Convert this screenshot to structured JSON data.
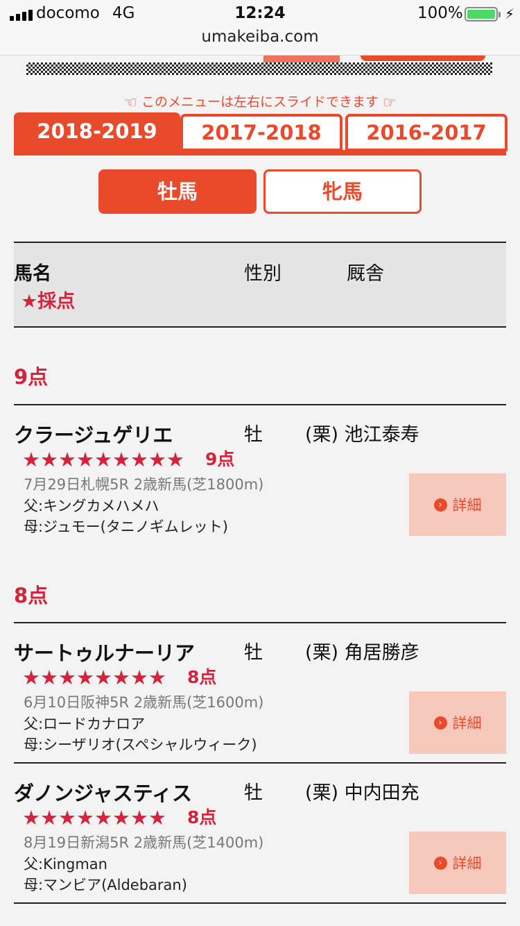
{
  "status_bar": {
    "carrier": "docomo",
    "network": "4G",
    "time": "12:24",
    "battery": "100%",
    "url": "umakeiba.com"
  },
  "slide_hint": "このメニューは左右にスライドできます",
  "year_tabs": [
    "2018-2019",
    "2017-2018",
    "2016-2017"
  ],
  "gender_tabs": {
    "colt": "牡馬",
    "filly": "牝馬"
  },
  "table_header": {
    "name": "馬名",
    "sex": "性別",
    "stable": "厩舎",
    "score": "★採点"
  },
  "groups": [
    {
      "label": "9点"
    },
    {
      "label": "8点"
    }
  ],
  "horses": [
    {
      "name": "クラージュゲリエ",
      "sex": "牡",
      "stable": "(栗) 池江泰寿",
      "stars": "★★★★★★★★★",
      "score": "9点",
      "race": "7月29日札幌5R 2歳新馬(芝1800m)",
      "sire": "父:キングカメハメハ",
      "dam": "母:ジュモー(タニノギムレット)",
      "detail": "詳細"
    },
    {
      "name": "サートゥルナーリア",
      "sex": "牡",
      "stable": "(栗) 角居勝彦",
      "stars": "★★★★★★★★",
      "score": "8点",
      "race": "6月10日阪神5R 2歳新馬(芝1600m)",
      "sire": "父:ロードカナロア",
      "dam": "母:シーザリオ(スペシャルウィーク)",
      "detail": "詳細"
    },
    {
      "name": "ダノンジャスティス",
      "sex": "牡",
      "stable": "(栗) 中内田充",
      "stars": "★★★★★★★★",
      "score": "8点",
      "race": "8月19日新潟5R 2歳新馬(芝1400m)",
      "sire": "父:Kingman",
      "dam": "母:マンビア(Aldebaran)",
      "detail": "詳細"
    }
  ],
  "colors": {
    "accent": "#e84a2b",
    "score_red": "#d5233b",
    "detail_bg": "#f7c8bc"
  }
}
